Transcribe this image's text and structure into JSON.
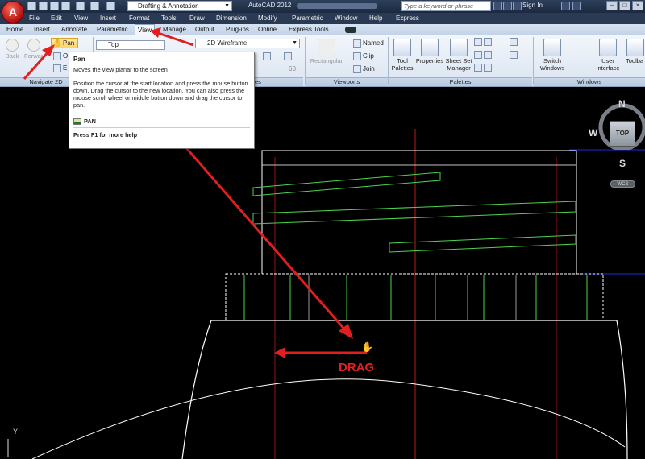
{
  "title_bar": {
    "app_button_letter": "A",
    "workspace": "Drafting & Annotation",
    "app_title": "AutoCAD 2012",
    "search_placeholder": "Type a keyword or phrase",
    "sign_in": "Sign In",
    "window_controls": [
      "–",
      "□",
      "×"
    ]
  },
  "menu_bar": [
    "File",
    "Edit",
    "View",
    "Insert",
    "Format",
    "Tools",
    "Draw",
    "Dimension",
    "Modify",
    "Parametric",
    "Window",
    "Help",
    "Express"
  ],
  "ribbon_tabs": [
    "Home",
    "Insert",
    "Annotate",
    "Parametric",
    "View",
    "Manage",
    "Output",
    "Plug-ins",
    "Online",
    "Express Tools"
  ],
  "active_tab": "View",
  "ribbon": {
    "navigate": {
      "back": "Back",
      "forward": "Forward",
      "pan": "Pan",
      "orbit_partial": "O",
      "extents_partial": "E",
      "panel_label": "Navigate 2D"
    },
    "views": {
      "view_combo": "Top"
    },
    "visual_styles": {
      "combo": "2D Wireframe",
      "value": "60",
      "panel_label_partial": "es"
    },
    "viewports": {
      "rectangular": "Rectangular",
      "named": "Named",
      "clip": "Clip",
      "join": "Join",
      "panel_label": "Viewports"
    },
    "palettes": {
      "tool_palettes": "Tool Palettes",
      "properties": "Properties",
      "sheet_set": "Sheet Set Manager",
      "panel_label": "Palettes"
    },
    "windows": {
      "switch_windows": "Switch Windows",
      "user_interface": "User Interface",
      "toolbars": "Toolba",
      "panel_label": "Windows"
    }
  },
  "tooltip": {
    "title": "Pan",
    "description": "Moves the view planar to the screen",
    "body": "Position the cursor at the start location and press the mouse button down. Drag the cursor to the new location. You can also press the mouse scroll wheel or middle button down and drag the cursor to pan.",
    "command": "PAN",
    "help": "Press F1 for more help"
  },
  "viewcube": {
    "n": "N",
    "s": "S",
    "w": "W",
    "top": "TOP",
    "wcs": "WCS"
  },
  "canvas": {
    "annotation": "DRAG",
    "axis_label": "Y"
  },
  "colors": {
    "annotation": "#e02020",
    "geometry": "#ffffff",
    "hatch": "#4cd44c",
    "centerline": "#c01818",
    "accent_blue": "#1a2be0"
  }
}
